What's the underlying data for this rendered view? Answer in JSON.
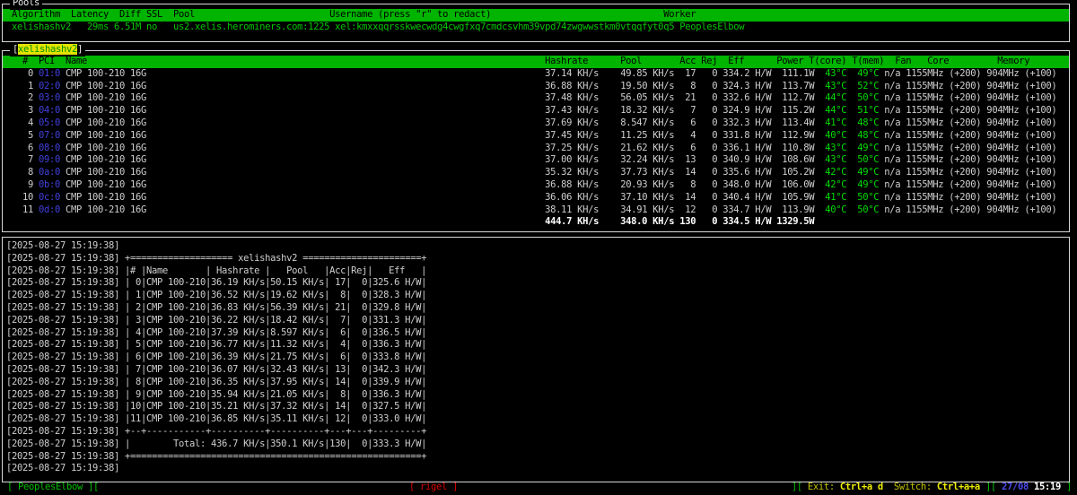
{
  "pools_panel": {
    "title": "Pools",
    "headers": {
      "algorithm": "Algorithm",
      "latency": "Latency",
      "diff": "Diff",
      "ssl": "SSL",
      "pool": "Pool",
      "username": "Username (press \"r\" to redact)",
      "worker": "Worker"
    },
    "row": {
      "algorithm": "xelishashv2",
      "latency": "29ms",
      "diff": "6.51M",
      "ssl": "no",
      "pool": "us2.xelis.herominers.com:1225",
      "username": "xel:kmxxqqrsskwecwdg4cwgfxq7cmdcsvhm39vpd74zwgwwstkm0vtqqfyt0q5",
      "worker": "PeoplesElbow"
    }
  },
  "gpu_panel": {
    "title": "xelishashv2",
    "headers": {
      "num": "#",
      "pci": "PCI",
      "name": "Name",
      "hashrate": "Hashrate",
      "pool": "Pool",
      "acc": "Acc",
      "rej": "Rej",
      "eff": "Eff",
      "power": "Power",
      "tcore": "T(core)",
      "tmem": "T(mem)",
      "fan": "Fan",
      "core": "Core",
      "memory": "Memory"
    },
    "rows": [
      {
        "num": "0",
        "pci": "01:0",
        "name": "CMP 100-210 16G",
        "hashrate": "37.14 KH/s",
        "pool": "49.85 KH/s",
        "acc": "17",
        "rej": "0",
        "eff": "334.2 H/W",
        "power": "111.1W",
        "tcore": "43°C",
        "tmem": "49°C",
        "fan": "n/a",
        "core": "1155MHz (+200)",
        "memory": "904MHz (+100)"
      },
      {
        "num": "1",
        "pci": "02:0",
        "name": "CMP 100-210 16G",
        "hashrate": "36.88 KH/s",
        "pool": "19.50 KH/s",
        "acc": "8",
        "rej": "0",
        "eff": "324.3 H/W",
        "power": "113.7W",
        "tcore": "43°C",
        "tmem": "52°C",
        "fan": "n/a",
        "core": "1155MHz (+200)",
        "memory": "904MHz (+100)"
      },
      {
        "num": "2",
        "pci": "03:0",
        "name": "CMP 100-210 16G",
        "hashrate": "37.48 KH/s",
        "pool": "56.05 KH/s",
        "acc": "21",
        "rej": "0",
        "eff": "332.6 H/W",
        "power": "112.7W",
        "tcore": "44°C",
        "tmem": "50°C",
        "fan": "n/a",
        "core": "1155MHz (+200)",
        "memory": "904MHz (+100)"
      },
      {
        "num": "3",
        "pci": "04:0",
        "name": "CMP 100-210 16G",
        "hashrate": "37.43 KH/s",
        "pool": "18.32 KH/s",
        "acc": "7",
        "rej": "0",
        "eff": "324.9 H/W",
        "power": "115.2W",
        "tcore": "44°C",
        "tmem": "51°C",
        "fan": "n/a",
        "core": "1155MHz (+200)",
        "memory": "904MHz (+100)"
      },
      {
        "num": "4",
        "pci": "05:0",
        "name": "CMP 100-210 16G",
        "hashrate": "37.69 KH/s",
        "pool": "8.547 KH/s",
        "acc": "6",
        "rej": "0",
        "eff": "332.3 H/W",
        "power": "113.4W",
        "tcore": "41°C",
        "tmem": "48°C",
        "fan": "n/a",
        "core": "1155MHz (+200)",
        "memory": "904MHz (+100)"
      },
      {
        "num": "5",
        "pci": "07:0",
        "name": "CMP 100-210 16G",
        "hashrate": "37.45 KH/s",
        "pool": "11.25 KH/s",
        "acc": "4",
        "rej": "0",
        "eff": "331.8 H/W",
        "power": "112.9W",
        "tcore": "40°C",
        "tmem": "48°C",
        "fan": "n/a",
        "core": "1155MHz (+200)",
        "memory": "904MHz (+100)"
      },
      {
        "num": "6",
        "pci": "08:0",
        "name": "CMP 100-210 16G",
        "hashrate": "37.25 KH/s",
        "pool": "21.62 KH/s",
        "acc": "6",
        "rej": "0",
        "eff": "336.1 H/W",
        "power": "110.8W",
        "tcore": "43°C",
        "tmem": "49°C",
        "fan": "n/a",
        "core": "1155MHz (+200)",
        "memory": "904MHz (+100)"
      },
      {
        "num": "7",
        "pci": "09:0",
        "name": "CMP 100-210 16G",
        "hashrate": "37.00 KH/s",
        "pool": "32.24 KH/s",
        "acc": "13",
        "rej": "0",
        "eff": "340.9 H/W",
        "power": "108.6W",
        "tcore": "43°C",
        "tmem": "50°C",
        "fan": "n/a",
        "core": "1155MHz (+200)",
        "memory": "904MHz (+100)"
      },
      {
        "num": "8",
        "pci": "0a:0",
        "name": "CMP 100-210 16G",
        "hashrate": "35.32 KH/s",
        "pool": "37.73 KH/s",
        "acc": "14",
        "rej": "0",
        "eff": "335.6 H/W",
        "power": "105.2W",
        "tcore": "42°C",
        "tmem": "49°C",
        "fan": "n/a",
        "core": "1155MHz (+200)",
        "memory": "904MHz (+100)"
      },
      {
        "num": "9",
        "pci": "0b:0",
        "name": "CMP 100-210 16G",
        "hashrate": "36.88 KH/s",
        "pool": "20.93 KH/s",
        "acc": "8",
        "rej": "0",
        "eff": "348.0 H/W",
        "power": "106.0W",
        "tcore": "42°C",
        "tmem": "49°C",
        "fan": "n/a",
        "core": "1155MHz (+200)",
        "memory": "904MHz (+100)"
      },
      {
        "num": "10",
        "pci": "0c:0",
        "name": "CMP 100-210 16G",
        "hashrate": "36.06 KH/s",
        "pool": "37.10 KH/s",
        "acc": "14",
        "rej": "0",
        "eff": "340.4 H/W",
        "power": "105.9W",
        "tcore": "41°C",
        "tmem": "50°C",
        "fan": "n/a",
        "core": "1155MHz (+200)",
        "memory": "904MHz (+100)"
      },
      {
        "num": "11",
        "pci": "0d:0",
        "name": "CMP 100-210 16G",
        "hashrate": "38.11 KH/s",
        "pool": "34.91 KH/s",
        "acc": "12",
        "rej": "0",
        "eff": "334.7 H/W",
        "power": "113.9W",
        "tcore": "40°C",
        "tmem": "50°C",
        "fan": "n/a",
        "core": "1155MHz (+200)",
        "memory": "904MHz (+100)"
      }
    ],
    "total": {
      "hashrate": "444.7 KH/s",
      "pool": "348.0 KH/s",
      "acc": "130",
      "rej": "0",
      "eff": "334.5 H/W",
      "power": "1329.5W"
    }
  },
  "log_panel": {
    "timestamp": "[2025-08-27 15:19:38]",
    "banner_title": "xelishashv2",
    "headers": {
      "num": "#",
      "name": "Name",
      "hashrate": "Hashrate",
      "pool": "Pool",
      "acc": "Acc",
      "rej": "Rej",
      "eff": "Eff"
    },
    "rows": [
      {
        "num": "0",
        "name": "CMP 100-210",
        "hashrate": "36.19 KH/s",
        "pool": "50.15 KH/s",
        "acc": "17",
        "rej": "0",
        "eff": "325.6 H/W"
      },
      {
        "num": "1",
        "name": "CMP 100-210",
        "hashrate": "36.52 KH/s",
        "pool": "19.62 KH/s",
        "acc": "8",
        "rej": "0",
        "eff": "328.3 H/W"
      },
      {
        "num": "2",
        "name": "CMP 100-210",
        "hashrate": "36.83 KH/s",
        "pool": "56.39 KH/s",
        "acc": "21",
        "rej": "0",
        "eff": "329.8 H/W"
      },
      {
        "num": "3",
        "name": "CMP 100-210",
        "hashrate": "36.22 KH/s",
        "pool": "18.42 KH/s",
        "acc": "7",
        "rej": "0",
        "eff": "331.3 H/W"
      },
      {
        "num": "4",
        "name": "CMP 100-210",
        "hashrate": "37.39 KH/s",
        "pool": "8.597 KH/s",
        "acc": "6",
        "rej": "0",
        "eff": "336.5 H/W"
      },
      {
        "num": "5",
        "name": "CMP 100-210",
        "hashrate": "36.77 KH/s",
        "pool": "11.32 KH/s",
        "acc": "4",
        "rej": "0",
        "eff": "336.3 H/W"
      },
      {
        "num": "6",
        "name": "CMP 100-210",
        "hashrate": "36.39 KH/s",
        "pool": "21.75 KH/s",
        "acc": "6",
        "rej": "0",
        "eff": "333.8 H/W"
      },
      {
        "num": "7",
        "name": "CMP 100-210",
        "hashrate": "36.07 KH/s",
        "pool": "32.43 KH/s",
        "acc": "13",
        "rej": "0",
        "eff": "342.3 H/W"
      },
      {
        "num": "8",
        "name": "CMP 100-210",
        "hashrate": "36.35 KH/s",
        "pool": "37.95 KH/s",
        "acc": "14",
        "rej": "0",
        "eff": "339.9 H/W"
      },
      {
        "num": "9",
        "name": "CMP 100-210",
        "hashrate": "35.94 KH/s",
        "pool": "21.05 KH/s",
        "acc": "8",
        "rej": "0",
        "eff": "336.3 H/W"
      },
      {
        "num": "10",
        "name": "CMP 100-210",
        "hashrate": "35.21 KH/s",
        "pool": "37.32 KH/s",
        "acc": "14",
        "rej": "0",
        "eff": "327.5 H/W"
      },
      {
        "num": "11",
        "name": "CMP 100-210",
        "hashrate": "36.85 KH/s",
        "pool": "35.11 KH/s",
        "acc": "12",
        "rej": "0",
        "eff": "333.0 H/W"
      }
    ],
    "total_label": "Total:",
    "total": {
      "hashrate": "436.7 KH/s",
      "pool": "350.1 KH/s",
      "acc": "130",
      "rej": "0",
      "eff": "333.3 H/W"
    }
  },
  "status_bar": {
    "worker": "PeoplesElbow",
    "host": "rigel",
    "exit_label": "Exit:",
    "exit_keys": "Ctrl+a d",
    "switch_label": "Switch:",
    "switch_keys": "Ctrl+a+a",
    "date": "27/08",
    "time": "15:19"
  },
  "colors": {
    "header_bar_green": "#00b400",
    "text_green": "#00c800",
    "temp_green": "#00dc00",
    "pci_blue": "#4040dd",
    "status_red": "#d70000",
    "status_yellow": "#c2c200",
    "status_yellow_bold": "#eded00",
    "date_blue": "#4a4ae8",
    "total_white": "#ffffff",
    "log_gray": "#cfcfcf",
    "title_highlight_bg": "#e3e300",
    "title_highlight_fg": "#009100"
  }
}
